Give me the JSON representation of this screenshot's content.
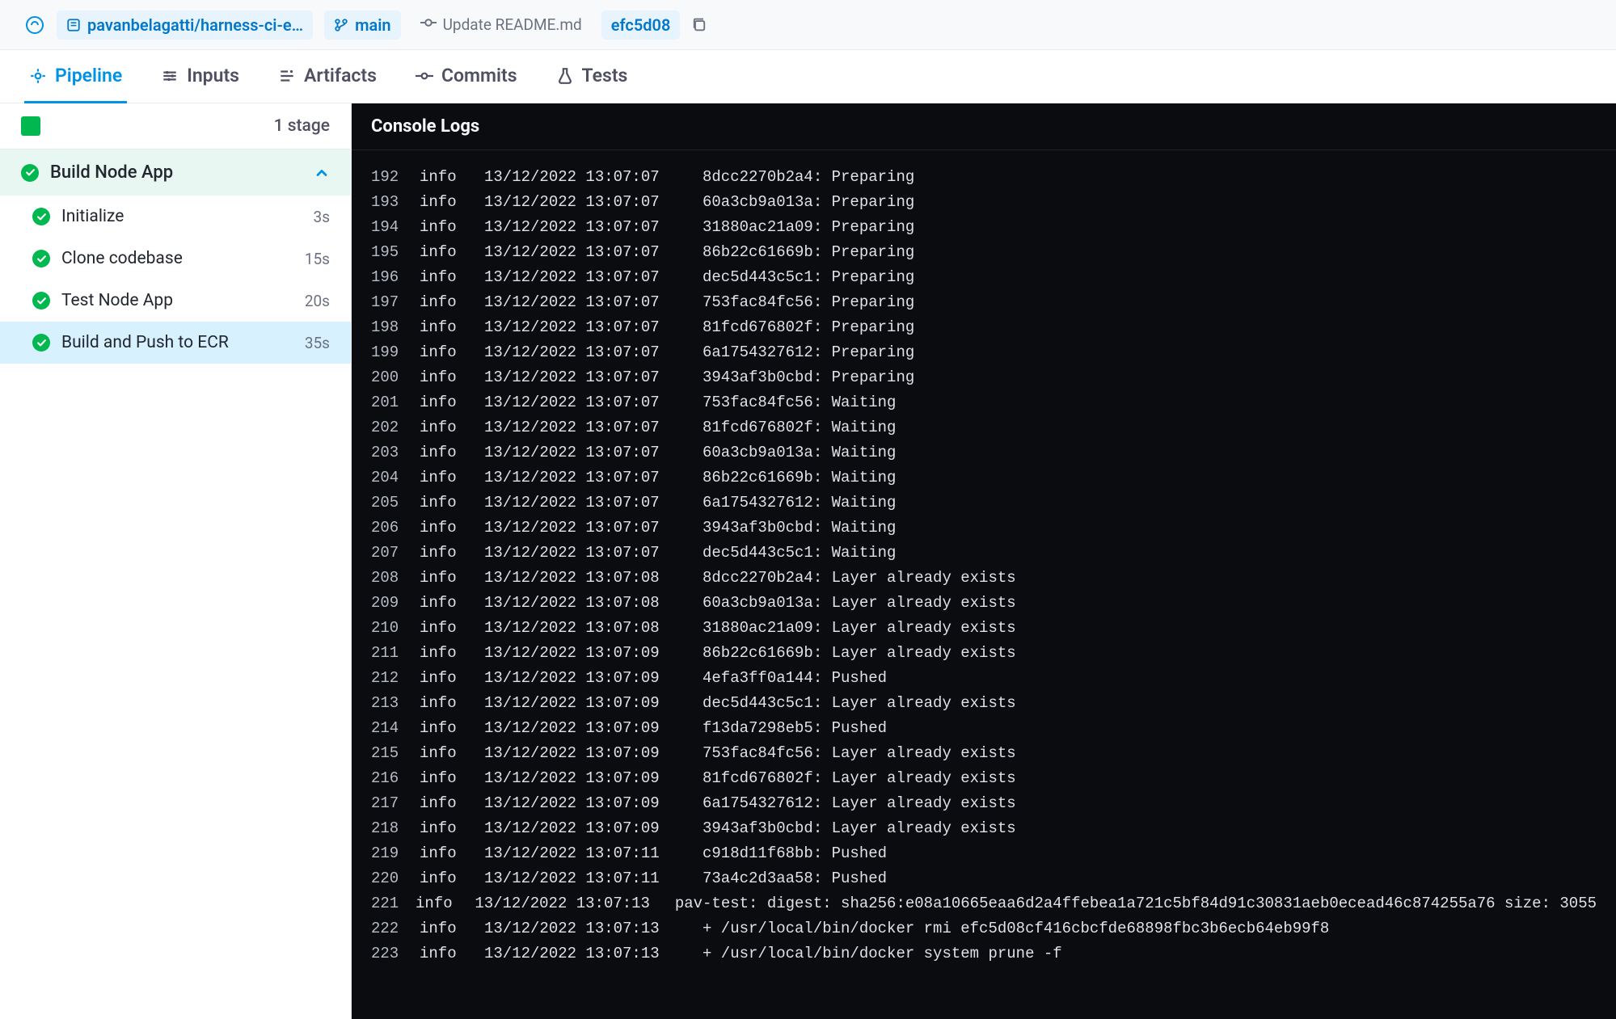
{
  "breadcrumb": {
    "repo": "pavanbelagatti/harness-ci-e…",
    "branch": "main",
    "commit_message": "Update README.md",
    "commit_hash": "efc5d08"
  },
  "tabs": [
    {
      "label": "Pipeline",
      "active": true
    },
    {
      "label": "Inputs",
      "active": false
    },
    {
      "label": "Artifacts",
      "active": false
    },
    {
      "label": "Commits",
      "active": false
    },
    {
      "label": "Tests",
      "active": false
    }
  ],
  "sidebar": {
    "stage_count_label": "1 stage",
    "stage": {
      "name": "Build Node App"
    },
    "steps": [
      {
        "name": "Initialize",
        "duration": "3s",
        "active": false
      },
      {
        "name": "Clone codebase",
        "duration": "15s",
        "active": false
      },
      {
        "name": "Test Node App",
        "duration": "20s",
        "active": false
      },
      {
        "name": "Build and Push to ECR",
        "duration": "35s",
        "active": true
      }
    ]
  },
  "console": {
    "title": "Console Logs",
    "logs": [
      {
        "n": "192",
        "l": "info",
        "t": "13/12/2022 13:07:07",
        "m": "8dcc2270b2a4: Preparing"
      },
      {
        "n": "193",
        "l": "info",
        "t": "13/12/2022 13:07:07",
        "m": "60a3cb9a013a: Preparing"
      },
      {
        "n": "194",
        "l": "info",
        "t": "13/12/2022 13:07:07",
        "m": "31880ac21a09: Preparing"
      },
      {
        "n": "195",
        "l": "info",
        "t": "13/12/2022 13:07:07",
        "m": "86b22c61669b: Preparing"
      },
      {
        "n": "196",
        "l": "info",
        "t": "13/12/2022 13:07:07",
        "m": "dec5d443c5c1: Preparing"
      },
      {
        "n": "197",
        "l": "info",
        "t": "13/12/2022 13:07:07",
        "m": "753fac84fc56: Preparing"
      },
      {
        "n": "198",
        "l": "info",
        "t": "13/12/2022 13:07:07",
        "m": "81fcd676802f: Preparing"
      },
      {
        "n": "199",
        "l": "info",
        "t": "13/12/2022 13:07:07",
        "m": "6a1754327612: Preparing"
      },
      {
        "n": "200",
        "l": "info",
        "t": "13/12/2022 13:07:07",
        "m": "3943af3b0cbd: Preparing"
      },
      {
        "n": "201",
        "l": "info",
        "t": "13/12/2022 13:07:07",
        "m": "753fac84fc56: Waiting"
      },
      {
        "n": "202",
        "l": "info",
        "t": "13/12/2022 13:07:07",
        "m": "81fcd676802f: Waiting"
      },
      {
        "n": "203",
        "l": "info",
        "t": "13/12/2022 13:07:07",
        "m": "60a3cb9a013a: Waiting"
      },
      {
        "n": "204",
        "l": "info",
        "t": "13/12/2022 13:07:07",
        "m": "86b22c61669b: Waiting"
      },
      {
        "n": "205",
        "l": "info",
        "t": "13/12/2022 13:07:07",
        "m": "6a1754327612: Waiting"
      },
      {
        "n": "206",
        "l": "info",
        "t": "13/12/2022 13:07:07",
        "m": "3943af3b0cbd: Waiting"
      },
      {
        "n": "207",
        "l": "info",
        "t": "13/12/2022 13:07:07",
        "m": "dec5d443c5c1: Waiting"
      },
      {
        "n": "208",
        "l": "info",
        "t": "13/12/2022 13:07:08",
        "m": "8dcc2270b2a4: Layer already exists"
      },
      {
        "n": "209",
        "l": "info",
        "t": "13/12/2022 13:07:08",
        "m": "60a3cb9a013a: Layer already exists"
      },
      {
        "n": "210",
        "l": "info",
        "t": "13/12/2022 13:07:08",
        "m": "31880ac21a09: Layer already exists"
      },
      {
        "n": "211",
        "l": "info",
        "t": "13/12/2022 13:07:09",
        "m": "86b22c61669b: Layer already exists"
      },
      {
        "n": "212",
        "l": "info",
        "t": "13/12/2022 13:07:09",
        "m": "4efa3ff0a144: Pushed"
      },
      {
        "n": "213",
        "l": "info",
        "t": "13/12/2022 13:07:09",
        "m": "dec5d443c5c1: Layer already exists"
      },
      {
        "n": "214",
        "l": "info",
        "t": "13/12/2022 13:07:09",
        "m": "f13da7298eb5: Pushed"
      },
      {
        "n": "215",
        "l": "info",
        "t": "13/12/2022 13:07:09",
        "m": "753fac84fc56: Layer already exists"
      },
      {
        "n": "216",
        "l": "info",
        "t": "13/12/2022 13:07:09",
        "m": "81fcd676802f: Layer already exists"
      },
      {
        "n": "217",
        "l": "info",
        "t": "13/12/2022 13:07:09",
        "m": "6a1754327612: Layer already exists"
      },
      {
        "n": "218",
        "l": "info",
        "t": "13/12/2022 13:07:09",
        "m": "3943af3b0cbd: Layer already exists"
      },
      {
        "n": "219",
        "l": "info",
        "t": "13/12/2022 13:07:11",
        "m": "c918d11f68bb: Pushed"
      },
      {
        "n": "220",
        "l": "info",
        "t": "13/12/2022 13:07:11",
        "m": "73a4c2d3aa58: Pushed"
      },
      {
        "n": "221",
        "l": "info",
        "t": "13/12/2022 13:07:13",
        "m": "pav-test: digest: sha256:e08a10665eaa6d2a4ffebea1a721c5bf84d91c30831aeb0ecead46c874255a76 size: 3055"
      },
      {
        "n": "222",
        "l": "info",
        "t": "13/12/2022 13:07:13",
        "m": "+ /usr/local/bin/docker rmi efc5d08cf416cbcfde68898fbc3b6ecb64eb99f8"
      },
      {
        "n": "223",
        "l": "info",
        "t": "13/12/2022 13:07:13",
        "m": "+ /usr/local/bin/docker system prune -f"
      }
    ]
  }
}
